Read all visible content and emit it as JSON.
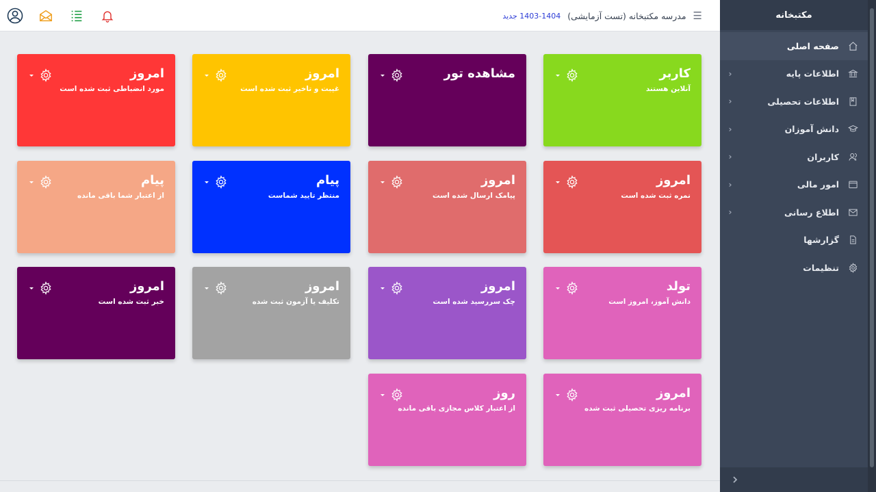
{
  "sidebar": {
    "header": "مکتبخانه",
    "items": [
      {
        "label": "صفحه اصلی",
        "icon": "home-icon",
        "active": true,
        "has_submenu": false
      },
      {
        "label": "اطلاعات پایه",
        "icon": "bank-icon",
        "active": false,
        "has_submenu": true
      },
      {
        "label": "اطلاعات تحصیلی",
        "icon": "book-icon",
        "active": false,
        "has_submenu": true
      },
      {
        "label": "دانش آموزان",
        "icon": "graduation-cap-icon",
        "active": false,
        "has_submenu": true
      },
      {
        "label": "کاربران",
        "icon": "users-icon",
        "active": false,
        "has_submenu": true
      },
      {
        "label": "امور مالی",
        "icon": "wallet-icon",
        "active": false,
        "has_submenu": true
      },
      {
        "label": "اطلاع رسانی",
        "icon": "envelope-icon",
        "active": false,
        "has_submenu": true
      },
      {
        "label": "گزارشها",
        "icon": "file-icon",
        "active": false,
        "has_submenu": false
      },
      {
        "label": "تنظیمات",
        "icon": "gear-icon",
        "active": false,
        "has_submenu": false
      }
    ],
    "collapse_icon": "chevron-right-icon"
  },
  "topbar": {
    "school": "مدرسه مکتبخانه (تست آزمایشی)",
    "year": "1403-1404 جدید",
    "icons": [
      "user-circle-icon",
      "envelope-open-icon",
      "list-icon",
      "bell-icon"
    ],
    "icon_colors": {
      "user": "#1f3b57",
      "mail": "#f0a020",
      "list": "#22a047",
      "bell": "#e0322f"
    }
  },
  "cards": [
    {
      "title": "کاربر",
      "subtitle": "آنلاین هستند",
      "color": "#88d91e"
    },
    {
      "title": "مشاهده تور",
      "subtitle": "",
      "color": "#65005a"
    },
    {
      "title": "امروز",
      "subtitle": "غیبت و تاخیر ثبت شده است",
      "color": "#ffc400"
    },
    {
      "title": "امروز",
      "subtitle": "مورد انضباطی ثبت شده است",
      "color": "#ff3737"
    },
    {
      "title": "امروز",
      "subtitle": "نمره ثبت شده است",
      "color": "#e45555"
    },
    {
      "title": "امروز",
      "subtitle": "پیامک ارسال شده است",
      "color": "#e06c6c"
    },
    {
      "title": "پیام",
      "subtitle": "منتظر تایید شماست",
      "color": "#0031ff"
    },
    {
      "title": "پیام",
      "subtitle": "از اعتبار شما باقی مانده",
      "color": "#f5a786"
    },
    {
      "title": "تولد",
      "subtitle": "دانش آموز، امروز است",
      "color": "#e063bb"
    },
    {
      "title": "امروز",
      "subtitle": "چک سررسید شده است",
      "color": "#9b56c9"
    },
    {
      "title": "امروز",
      "subtitle": "تکلیف یا آزمون ثبت شده",
      "color": "#a3a3a3"
    },
    {
      "title": "امروز",
      "subtitle": "خبر ثبت شده است",
      "color": "#64005a"
    },
    {
      "title": "امروز",
      "subtitle": "برنامه ریزی تحصیلی ثبت شده",
      "color": "#e063bb"
    },
    {
      "title": "روز",
      "subtitle": "از اعتبار کلاس مجازی باقی مانده",
      "color": "#e063bb"
    }
  ]
}
